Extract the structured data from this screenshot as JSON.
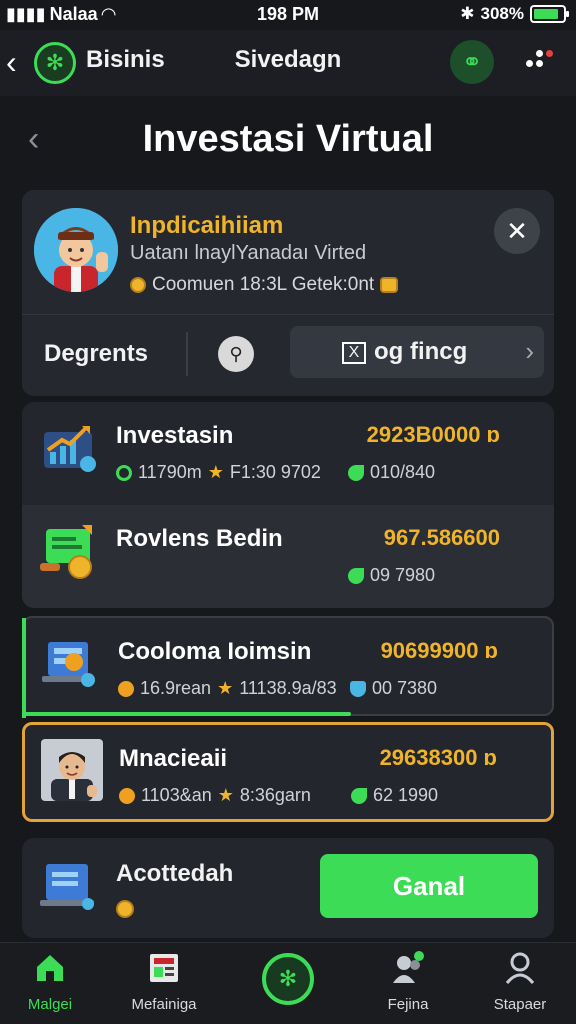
{
  "status": {
    "carrier": "Nalaa",
    "time": "198 PM",
    "battery": "308%",
    "battery_level": 0.85
  },
  "appbar": {
    "app_name": "Bisinis",
    "subtitle": "Sivedagn"
  },
  "page": {
    "title": "Investasi Virtual"
  },
  "profile": {
    "name": "Inpdicaihiiam",
    "subtitle": "Uatanı lnaylYanadaı Virted",
    "meta": "Coomuen 18:3L Getek:0nt",
    "tab_label": "Degrents",
    "filter_box": "X",
    "filter_label": "og fincg"
  },
  "items": [
    {
      "title": "Investasin",
      "amount": "2923B0000 ɒ",
      "meta1": "11790m",
      "meta2": "F1:30 9702",
      "meta3": "010/840"
    },
    {
      "title": "Rovlens Bedin",
      "amount": "967.586600",
      "meta1": "",
      "meta2": "",
      "meta3": "09 7980"
    },
    {
      "title": "Coolomа Ioimsin",
      "amount": "90699900 ɒ",
      "meta1": "16.9rean",
      "meta2": "11138.9a/83",
      "meta3": "00 7380",
      "progress": 0.62
    },
    {
      "title": "Mnacieaii",
      "amount": "29638300 ɒ",
      "meta1": "1103&an",
      "meta2": "8:36garn",
      "meta3": "62 1990"
    }
  ],
  "bottom_card": {
    "title": "Acottedah",
    "button": "Ganal"
  },
  "nav": [
    {
      "label": "Malgei"
    },
    {
      "label": "Mefainiga"
    },
    {
      "label": ""
    },
    {
      "label": "Fejina"
    },
    {
      "label": "Stapaer"
    }
  ],
  "colors": {
    "accent": "#3ddc56",
    "gold": "#f0b42b",
    "highlight_border": "#e2a33a",
    "background": "#16181c"
  }
}
